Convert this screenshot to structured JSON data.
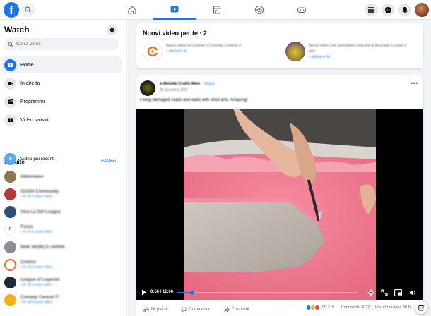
{
  "topbar": {
    "logo": "f",
    "icons": [
      "home-icon",
      "watch-icon",
      "marketplace-icon",
      "groups-icon",
      "gaming-icon"
    ],
    "active_tab": "watch",
    "right_icons": [
      "menu-grid-icon",
      "messenger-icon",
      "notifications-icon"
    ],
    "accent": "#1877f2"
  },
  "sidebar": {
    "title": "Watch",
    "search_placeholder": "Cerca video",
    "menu": [
      {
        "label": "Home",
        "icon": "home-icon",
        "active": true
      },
      {
        "label": "In diretta",
        "icon": "live-video-icon",
        "active": false
      },
      {
        "label": "Programmi",
        "icon": "shows-icon",
        "active": false
      },
      {
        "label": "Video salvati",
        "icon": "saved-icon",
        "active": false
      }
    ],
    "following_title": "Seguite",
    "manage_label": "Gestisci",
    "following": [
      {
        "name": "Video più recenti",
        "sub": "",
        "color": "#58a7f1"
      },
      {
        "name": "Abbonatevi",
        "sub": "",
        "color": "#8a7a4e"
      },
      {
        "name": "OUGH Community",
        "sub": "• 9+ di 9 nuovi video",
        "color": "#b23a3a"
      },
      {
        "name": "Viva La Dirt League",
        "sub": "",
        "color": "#2d4f7a"
      },
      {
        "name": "Focus",
        "sub": "• 9+ di 9 nuovi video",
        "color": "#c8221c"
      },
      {
        "name": "NHK WORLD-JAPAN",
        "sub": "",
        "color": "#8c8f96"
      },
      {
        "name": "Cookist",
        "sub": "• 9+ di 9 nuovi video",
        "color": "#f26b23"
      },
      {
        "name": "League of Legends",
        "sub": "• 9+ di 9 nuovi video",
        "color": "#1f2a3a"
      },
      {
        "name": "Comedy Central IT",
        "sub": "• 9+ di 9 nuovi video",
        "color": "#f1b21f"
      }
    ]
  },
  "new_videos": {
    "title": "Nuovi video per te · 2",
    "items": [
      {
        "text": "Nuovi video di Cookist e Comedy Central IT.",
        "link": "• ottenere fe",
        "color": "#ffffff",
        "ring": "#f26b23"
      },
      {
        "text": "Nuovi video che potrebbero piacerti di Avocado Couple e altri.",
        "link": "• ottenere fe",
        "color": "#b49a35",
        "ring": "#8b5cc7"
      }
    ]
  },
  "post": {
    "author": "5 Minute Crafts Men",
    "follow_label": "· Segui",
    "date": "26 dicembre 2021 · ",
    "caption": "Fixing damaged roads and walls with strict arts. Amazing!",
    "video": {
      "time_label": "0:56 / 11:06",
      "progress": 0.085
    },
    "actions": [
      {
        "label": "Mi piace",
        "icon": "like-icon"
      },
      {
        "label": "Commenta",
        "icon": "comment-icon"
      },
      {
        "label": "Condividi",
        "icon": "share-icon"
      }
    ],
    "reaction_count": "95 319",
    "comments": "Commenti: 3072",
    "views": "Visualizzazioni: 30 M"
  }
}
